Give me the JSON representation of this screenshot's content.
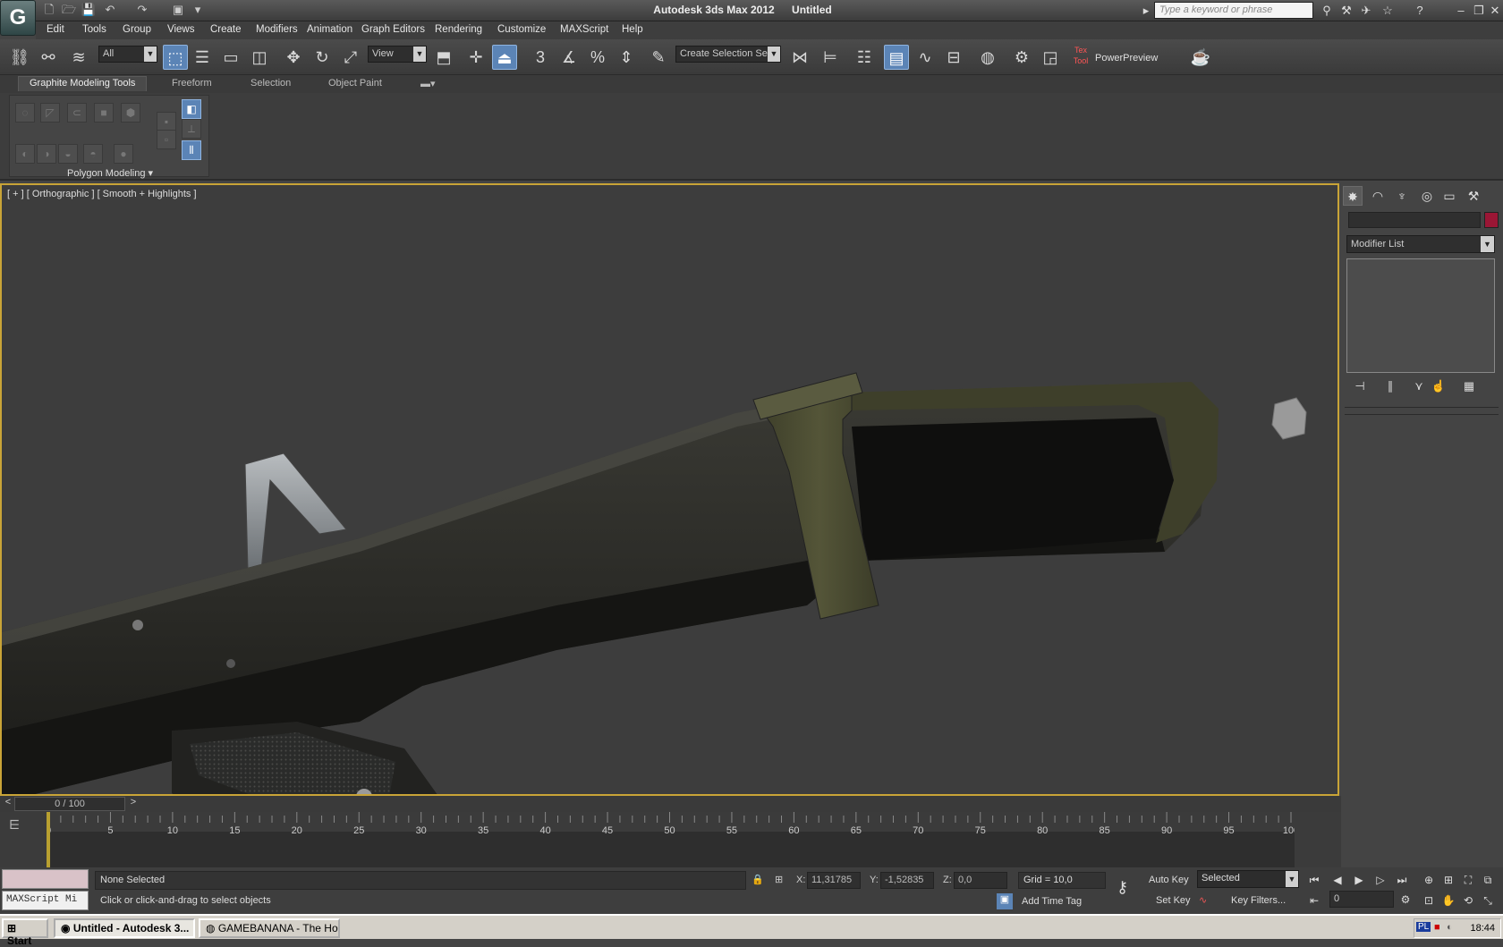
{
  "title": {
    "app": "Autodesk 3ds Max  2012",
    "document": "Untitled"
  },
  "search": {
    "placeholder": "Type a keyword or phrase"
  },
  "menu": [
    "Edit",
    "Tools",
    "Group",
    "Views",
    "Create",
    "Modifiers",
    "Animation",
    "Graph Editors",
    "Rendering",
    "Customize",
    "MAXScript",
    "Help"
  ],
  "toolbar": {
    "filter_value": "All",
    "ref_coord": "View",
    "named_selection_placeholder": "Create Selection Se",
    "snap_label": "3",
    "powerpreview": "PowerPreview",
    "texttool_label": "Tex Tool"
  },
  "ribbon": {
    "tabs": [
      "Graphite Modeling Tools",
      "Freeform",
      "Selection",
      "Object Paint"
    ],
    "group_label": "Polygon Modeling"
  },
  "viewport": {
    "label": "[ + ] [ Orthographic ] [ Smooth + Highlights ]"
  },
  "command_panel": {
    "modifier_list": "Modifier List"
  },
  "timeline": {
    "slider_label": "0 / 100",
    "ticks": [
      0,
      5,
      10,
      15,
      20,
      25,
      30,
      35,
      40,
      45,
      50,
      55,
      60,
      65,
      70,
      75,
      80,
      85,
      90,
      95,
      100
    ],
    "max_frame": 100
  },
  "status": {
    "maxscript": "MAXScript Mi",
    "selection": "None Selected",
    "prompt": "Click or click-and-drag to select objects",
    "x_label": "X:",
    "x": "11,31785",
    "y_label": "Y:",
    "y": "-1,52835",
    "z_label": "Z:",
    "z": "0,0",
    "grid": "Grid = 10,0",
    "add_time_tag": "Add Time Tag",
    "auto_key": "Auto Key",
    "set_key": "Set Key",
    "key_mode": "Selected",
    "key_filters": "Key Filters...",
    "current_frame": "0"
  },
  "taskbar": {
    "start": "Start",
    "tasks": [
      "Untitled - Autodesk 3...",
      "GAMEBANANA - The Ho..."
    ],
    "lang": "PL",
    "clock": "18:44"
  },
  "colors": {
    "viewport_border": "#c9a437",
    "object_color": "#9b1635",
    "active_tool": "#5b84b6"
  }
}
